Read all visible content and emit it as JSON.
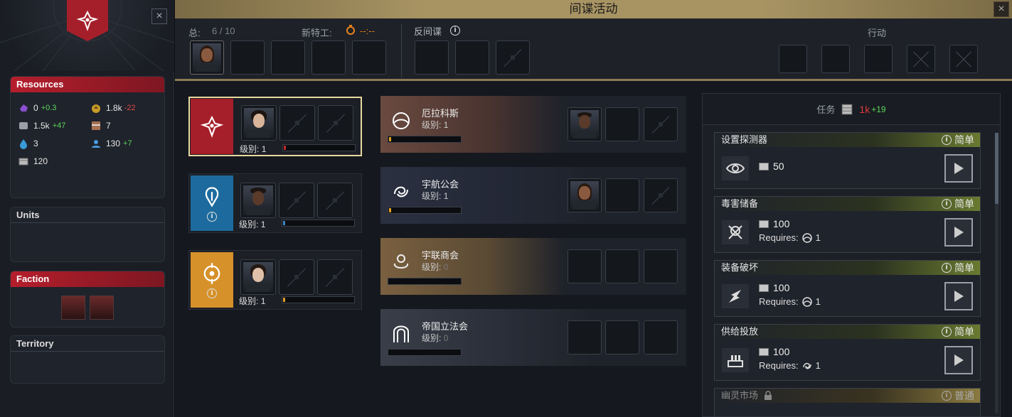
{
  "window": {
    "title": "间谍活动"
  },
  "left_panel": {
    "resources": {
      "title": "Resources",
      "items": [
        {
          "icon": "crystal-icon",
          "value": "0",
          "delta": "+0.3",
          "delta_type": "pos"
        },
        {
          "icon": "influence-icon",
          "value": "1.8k",
          "delta": "-22",
          "delta_type": "neg"
        },
        {
          "icon": "alloy-icon",
          "value": "1.5k",
          "delta": "+47",
          "delta_type": "pos"
        },
        {
          "icon": "materials-icon",
          "value": "7",
          "delta": "",
          "delta_type": ""
        },
        {
          "icon": "water-icon",
          "value": "3",
          "delta": "",
          "delta_type": ""
        },
        {
          "icon": "population-icon",
          "value": "130",
          "delta": "+7",
          "delta_type": "pos"
        },
        {
          "icon": "credits-icon",
          "value": "120",
          "delta": "",
          "delta_type": ""
        }
      ]
    },
    "units": {
      "title": "Units"
    },
    "faction": {
      "title": "Faction"
    },
    "territory": {
      "title": "Territory"
    }
  },
  "top": {
    "total_label": "总:",
    "total_value": "6 / 10",
    "new_agent_label": "新特工:",
    "new_agent_timer": "--:--",
    "counter_intel_label": "反间谍",
    "actions_label": "行动"
  },
  "factions": [
    {
      "name": "red-faction",
      "level_label": "级别:",
      "level": "1",
      "progress": 0.02,
      "color": "#a51f2a",
      "bar_color": "#c0282a",
      "has_info": false
    },
    {
      "name": "blue-faction",
      "level_label": "级别:",
      "level": "1",
      "progress": 0.02,
      "color": "#1d6b9e",
      "bar_color": "#3a86c0",
      "has_info": true
    },
    {
      "name": "gold-faction",
      "level_label": "级别:",
      "level": "1",
      "progress": 0.02,
      "color": "#d6912a",
      "bar_color": "#e09a2a",
      "has_info": true
    }
  ],
  "organizations": [
    {
      "name": "厄拉科斯",
      "level_label": "级别:",
      "level": "1",
      "progress": 0.03,
      "has_agent": true,
      "agent_type": "male-dark"
    },
    {
      "name": "宇航公会",
      "level_label": "级别:",
      "level": "1",
      "progress": 0.03,
      "has_agent": true,
      "agent_type": "female"
    },
    {
      "name": "宇联商会",
      "level_label": "级别:",
      "level": "0",
      "progress": 0,
      "has_agent": false
    },
    {
      "name": "帝国立法会",
      "level_label": "级别:",
      "level": "0",
      "progress": 0,
      "has_agent": false
    }
  ],
  "tasks_panel": {
    "header_label": "任务",
    "credits": "1k",
    "credits_delta": "+19",
    "tasks": [
      {
        "title": "设置探测器",
        "difficulty": "简单",
        "cost": "50",
        "requires": "",
        "requires_label": "",
        "icon": "eye-icon",
        "locked": false
      },
      {
        "title": "毒害储备",
        "difficulty": "简单",
        "cost": "100",
        "requires_label": "Requires:",
        "requires": "1",
        "icon": "poison-icon",
        "locked": false
      },
      {
        "title": "装备破坏",
        "difficulty": "简单",
        "cost": "100",
        "requires_label": "Requires:",
        "requires": "1",
        "icon": "sabotage-icon",
        "locked": false
      },
      {
        "title": "供给投放",
        "difficulty": "简单",
        "cost": "100",
        "requires_label": "Requires:",
        "requires": "1",
        "icon": "supply-icon",
        "locked": false
      },
      {
        "title": "幽灵市场",
        "difficulty": "普通",
        "cost": "",
        "requires_label": "",
        "requires": "",
        "icon": "",
        "locked": true
      }
    ]
  }
}
